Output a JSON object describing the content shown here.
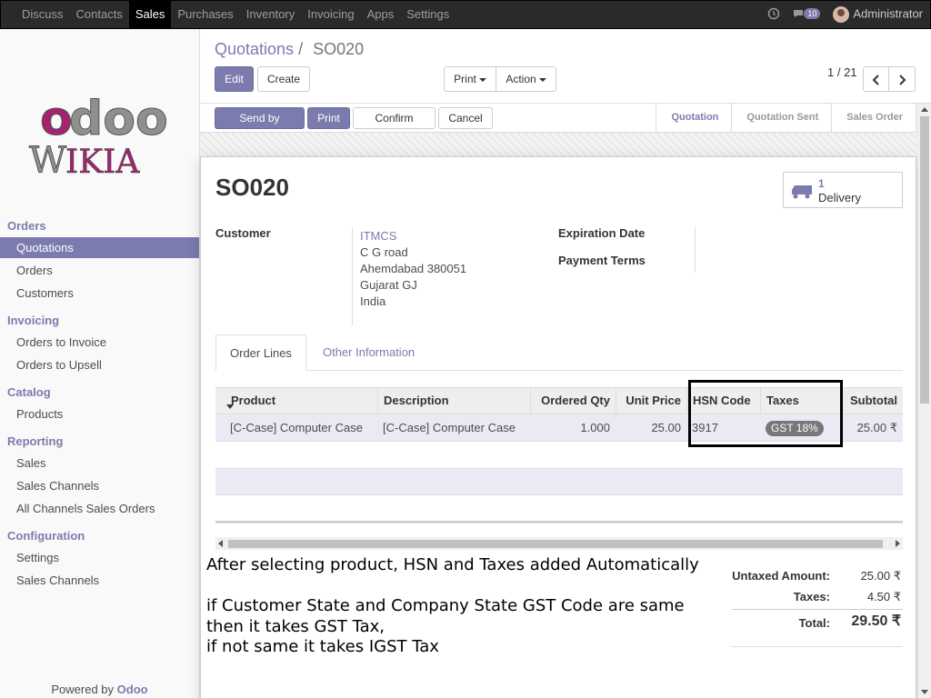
{
  "topbar": {
    "menu": [
      "Discuss",
      "Contacts",
      "Sales",
      "Purchases",
      "Inventory",
      "Invoicing",
      "Apps",
      "Settings"
    ],
    "active": "Sales",
    "messages_count": "10",
    "user": "Administrator"
  },
  "sidebar": {
    "groups": [
      {
        "title": "Orders",
        "items": [
          "Quotations",
          "Orders",
          "Customers"
        ]
      },
      {
        "title": "Invoicing",
        "items": [
          "Orders to Invoice",
          "Orders to Upsell"
        ]
      },
      {
        "title": "Catalog",
        "items": [
          "Products"
        ]
      },
      {
        "title": "Reporting",
        "items": [
          "Sales",
          "Sales Channels",
          "All Channels Sales Orders"
        ]
      },
      {
        "title": "Configuration",
        "items": [
          "Settings",
          "Sales Channels"
        ]
      }
    ],
    "active_item": "Quotations",
    "logo_text_1": "odoo",
    "logo_text_2": "WIKIA",
    "powered_prefix": "Powered by ",
    "powered_brand": "Odoo"
  },
  "control_panel": {
    "breadcrumb_parent": "Quotations",
    "breadcrumb_sep": "/",
    "breadcrumb_current": "SO020",
    "edit_label": "Edit",
    "create_label": "Create",
    "print_label": "Print",
    "action_label": "Action",
    "pager": "1 / 21"
  },
  "statusbar": {
    "buttons": [
      "Send by Email",
      "Print",
      "Confirm Sale",
      "Cancel"
    ],
    "stages": [
      "Quotation",
      "Quotation Sent",
      "Sales Order"
    ],
    "current_stage": "Quotation"
  },
  "form": {
    "name": "SO020",
    "delivery_count": "1",
    "delivery_label": "Delivery",
    "customer_label": "Customer",
    "customer_name": "ITMCS",
    "customer_address": [
      "C G road",
      "Ahemdabad 380051",
      "Gujarat GJ",
      "India"
    ],
    "expiration_label": "Expiration Date",
    "payment_terms_label": "Payment Terms",
    "tabs": [
      "Order Lines",
      "Other Information"
    ],
    "columns": [
      "Product",
      "Description",
      "Ordered Qty",
      "Unit Price",
      "HSN Code",
      "Taxes",
      "Subtotal"
    ],
    "lines": [
      {
        "product": "[C-Case] Computer Case",
        "description": "[C-Case] Computer Case",
        "qty": "1.000",
        "price": "25.00",
        "hsn": "3917",
        "tax": "GST 18%",
        "subtotal": "25.00 ₹"
      }
    ],
    "untaxed_label": "Untaxed Amount:",
    "untaxed_value": "25.00 ₹",
    "taxes_label": "Taxes:",
    "taxes_value": "4.50 ₹",
    "total_label": "Total:",
    "total_value": "29.50 ₹"
  },
  "annotation": {
    "line1": "After selecting product, HSN and Taxes added Automatically",
    "line2": "if Customer State and Company State GST Code are same",
    "line3": "then it takes GST Tax,",
    "line4": "if not same it takes IGST Tax"
  },
  "colors": {
    "accent": "#7c7bad",
    "topbar": "#2a2a2a",
    "logo_magenta": "#a3236e",
    "logo_grey": "#8f8f8f"
  }
}
